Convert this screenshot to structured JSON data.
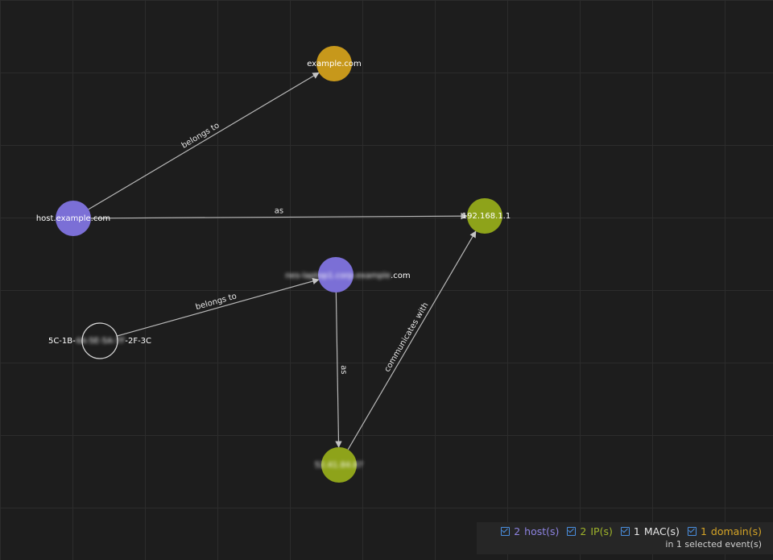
{
  "colors": {
    "host": "#7b6fd6",
    "ip": "#8ea31a",
    "mac": "#1d1d1d",
    "domain": "#c7981b",
    "legend_host": "#8e84e3",
    "legend_ip": "#9fb42a",
    "legend_mac": "#e8e8e8",
    "legend_domain": "#d6a526"
  },
  "nodes": [
    {
      "id": "domain1",
      "type": "domain",
      "label": "example.com",
      "redacted": false
    },
    {
      "id": "host1",
      "type": "host",
      "label": "host.example.com",
      "redacted": false
    },
    {
      "id": "ip1",
      "type": "ip",
      "label": "192.168.1.1",
      "redacted": false
    },
    {
      "id": "host2",
      "type": "host",
      "label_redacted": "nes-laptop1.corp.example",
      "label_visible": ".com",
      "redacted": true
    },
    {
      "id": "mac1",
      "type": "mac",
      "label_prefix": "5C-1B-",
      "label_redacted": "4A-5E-5A-7F",
      "label_suffix": "-2F-3C",
      "redacted": true
    },
    {
      "id": "ip2",
      "type": "ip",
      "label_redacted": "52.41.84.87",
      "redacted": true
    }
  ],
  "edges": [
    {
      "from": "host1",
      "to": "domain1",
      "label": "belongs to"
    },
    {
      "from": "host1",
      "to": "ip1",
      "label": "as"
    },
    {
      "from": "mac1",
      "to": "host2",
      "label": "belongs to"
    },
    {
      "from": "host2",
      "to": "ip2",
      "label": "as"
    },
    {
      "from": "ip2",
      "to": "ip1",
      "label": "communicates with"
    }
  ],
  "legend": {
    "items": [
      {
        "key": "host",
        "count": "2",
        "label": "host(s)",
        "checked": true
      },
      {
        "key": "ip",
        "count": "2",
        "label": "IP(s)",
        "checked": true
      },
      {
        "key": "mac",
        "count": "1",
        "label": "MAC(s)",
        "checked": true
      },
      {
        "key": "domain",
        "count": "1",
        "label": "domain(s)",
        "checked": true
      }
    ],
    "footer": "in 1 selected event(s)"
  }
}
